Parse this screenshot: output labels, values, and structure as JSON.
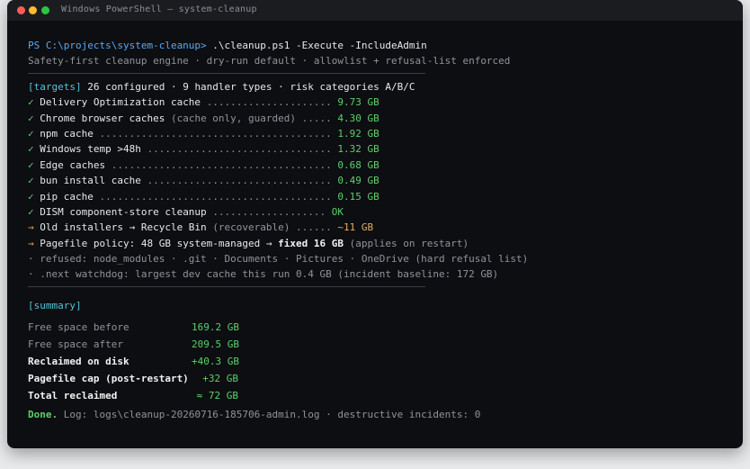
{
  "window": {
    "title": "Windows PowerShell — system-cleanup"
  },
  "prompt": {
    "path": "PS C:\\projects\\system-cleanup>",
    "command": " .\\cleanup.ps1 -Execute -IncludeAdmin",
    "subtitle": "Safety-first cleanup engine · dry-run default · allowlist + refusal-list enforced"
  },
  "targets": {
    "tag": "[targets]",
    "summary": " 26 configured · 9 handler types · risk categories A/B/C",
    "items": [
      {
        "mark": "✓",
        "label": " Delivery Optimization cache ",
        "note": "",
        "dots": "..................... ",
        "value": "9.73 GB"
      },
      {
        "mark": "✓",
        "label": " Chrome browser caches ",
        "note": "(cache only, guarded)",
        "dots": " ..... ",
        "value": "4.30 GB"
      },
      {
        "mark": "✓",
        "label": " npm cache ",
        "note": "",
        "dots": "....................................... ",
        "value": "1.92 GB"
      },
      {
        "mark": "✓",
        "label": " Windows temp >48h ",
        "note": "",
        "dots": "............................... ",
        "value": "1.32 GB"
      },
      {
        "mark": "✓",
        "label": " Edge caches ",
        "note": "",
        "dots": "..................................... ",
        "value": "0.68 GB"
      },
      {
        "mark": "✓",
        "label": " bun install cache ",
        "note": "",
        "dots": "............................... ",
        "value": "0.49 GB"
      },
      {
        "mark": "✓",
        "label": " pip cache ",
        "note": "",
        "dots": "....................................... ",
        "value": "0.15 GB"
      },
      {
        "mark": "✓",
        "label": " DISM component-store cleanup ",
        "note": "",
        "dots": "................... ",
        "value": "OK"
      }
    ],
    "installers": {
      "mark": "→",
      "label": " Old installers → Recycle Bin ",
      "note": "(recoverable)",
      "dots": " ...... ",
      "value": "~11 GB"
    },
    "pagefile": {
      "mark": "→",
      "label": " Pagefile policy: 48 GB system-managed → ",
      "strong": "fixed 16 GB",
      "note": " (applies on restart)"
    },
    "refused": "· refused: node_modules · .git · Documents · Pictures · OneDrive (hard refusal list)",
    "watchdog": "· .next watchdog: largest dev cache this run 0.4 GB (incident baseline: 172 GB)"
  },
  "summary": {
    "tag": "[summary]",
    "rows": [
      {
        "label": "Free space before",
        "value": "169.2 GB",
        "bold": false
      },
      {
        "label": "Free space after",
        "value": "209.5 GB",
        "bold": false
      },
      {
        "label": "Reclaimed on disk",
        "value": "+40.3 GB",
        "bold": true
      },
      {
        "label": "Pagefile cap (post-restart)",
        "value": "+32 GB",
        "bold": true
      },
      {
        "label": "Total reclaimed",
        "value": "≈ 72 GB",
        "bold": true
      }
    ]
  },
  "footer": {
    "done": "Done.",
    "log": " Log: logs\\cleanup-20260716-185706-admin.log · destructive incidents: 0"
  },
  "colors": {
    "accent_blue": "#5aa9f0",
    "success_green": "#5bd06a",
    "warning_orange": "#e0a64a"
  }
}
